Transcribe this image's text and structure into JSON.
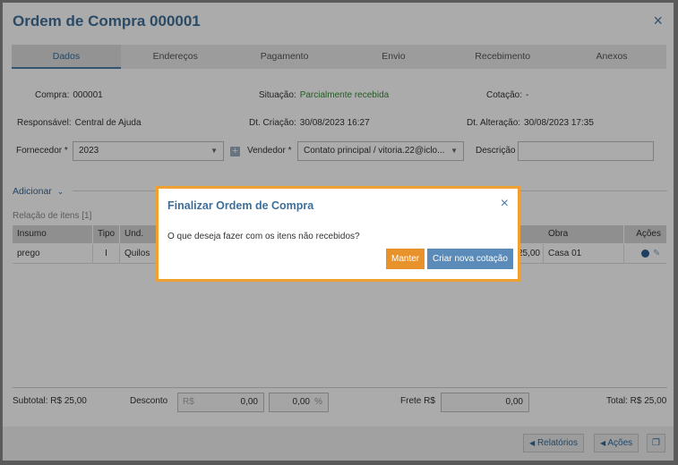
{
  "window": {
    "title": "Ordem de Compra 000001",
    "close_icon": "×"
  },
  "tabs": [
    {
      "label": "Dados"
    },
    {
      "label": "Endereços"
    },
    {
      "label": "Pagamento"
    },
    {
      "label": "Envio"
    },
    {
      "label": "Recebimento"
    },
    {
      "label": "Anexos"
    }
  ],
  "info": {
    "compra_label": "Compra:",
    "compra_value": "000001",
    "situacao_label": "Situação:",
    "situacao_value": "Parcialmente recebida",
    "cotacao_label": "Cotação:",
    "cotacao_value": "-",
    "responsavel_label": "Responsável:",
    "responsavel_value": "Central de Ajuda",
    "dt_criacao_label": "Dt. Criação:",
    "dt_criacao_value": "30/08/2023 16:27",
    "dt_alteracao_label": "Dt. Alteração:",
    "dt_alteracao_value": "30/08/2023 17:35"
  },
  "form": {
    "fornecedor_label": "Fornecedor *",
    "fornecedor_value": "2023",
    "vendedor_label": "Vendedor *",
    "vendedor_value": "Contato principal / vitoria.22@iclo...",
    "descricao_label": "Descrição"
  },
  "items": {
    "adicionar_label": "Adicionar",
    "relacao_label": "Relação de itens [1]",
    "headers": [
      "Insumo",
      "Tipo",
      "Und.",
      "Obra",
      "Ações"
    ],
    "rows": [
      {
        "insumo": "prego",
        "tipo": "I",
        "und": "Quilos",
        "valor": "25,00",
        "obra": "Casa 01"
      }
    ]
  },
  "totals": {
    "subtotal": "Subtotal: R$ 25,00",
    "desconto_label": "Desconto",
    "desconto_prefix": "R$",
    "desconto_value": "0,00",
    "desconto_pct_value": "0,00",
    "desconto_pct_suffix": "%",
    "frete_label": "Frete R$",
    "frete_value": "0,00",
    "total": "Total: R$ 25,00"
  },
  "footer": {
    "relatorios_label": "Relatórios",
    "acoes_label": "Ações"
  },
  "modal": {
    "title": "Finalizar Ordem de Compra",
    "message": "O que deseja fazer com os itens não recebidos?",
    "manter_label": "Manter",
    "criar_label": "Criar nova cotação"
  },
  "colors": {
    "accent": "#3f6f98",
    "modal_border": "#f0a030",
    "manter_button": "#e8922c",
    "criar_button": "#5b8bb8",
    "situacao_green": "#3a8a3a"
  }
}
